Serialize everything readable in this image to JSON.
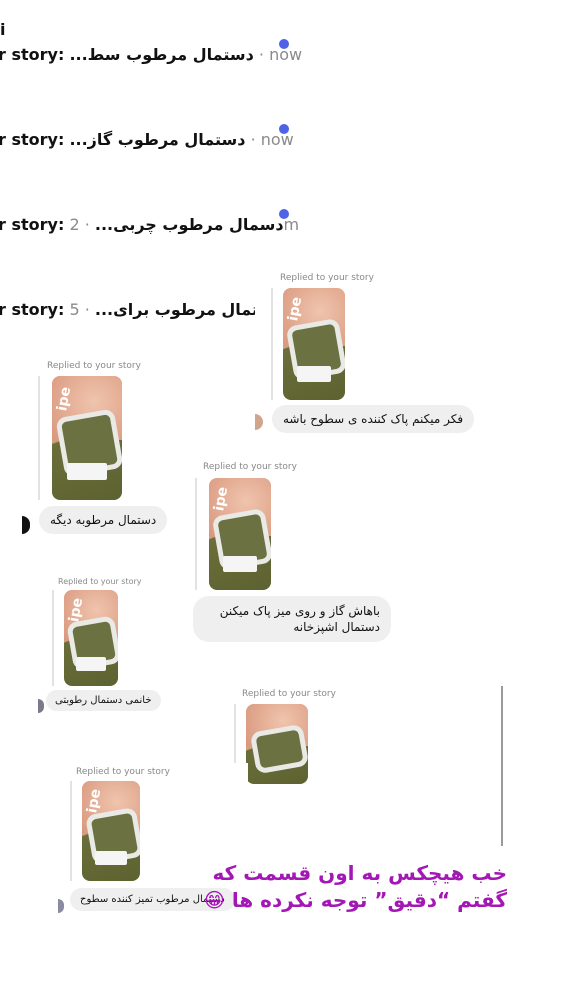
{
  "inbox": {
    "rows": [
      {
        "lead": "r story:",
        "message": "دستمال مرطوب سط...",
        "time": "· now",
        "unread": true
      },
      {
        "lead": "r story:",
        "message": "دستمال مرطوب گاز...",
        "time": "· now",
        "unread": true
      },
      {
        "lead": "r story:",
        "message": "دسمال مرطوب چربی...",
        "time": "· 2m",
        "unread": true
      },
      {
        "lead": "r story:",
        "message": "دستمال مرطوب برای...",
        "time": "· 5m",
        "unread": false
      }
    ],
    "top_fragment": "i"
  },
  "replies": [
    {
      "header": "Replied to your story",
      "message": "فکر میکنم پاک کننده ی سطوح باشه"
    },
    {
      "header": "Replied to your story",
      "message": "دستمال مرطوبه دیگه"
    },
    {
      "header": "Replied to your story",
      "message": "باهاش گاز و روی میز پاک میکنن دستمال اشپزخانه"
    },
    {
      "header": "Replied to your story",
      "message": "خانمی دستمال رطوبتی"
    },
    {
      "header": "Replied to your story",
      "message": ""
    },
    {
      "header": "Replied to your story",
      "message": "دستمال مرطوب تمیز کننده سطوح"
    }
  ],
  "caption": {
    "line1": "خب هیچکس به اون قسمت که",
    "line2": "گفتم “دقیق” توجه نکرده ها 😁"
  },
  "thumb_tag": "ipe"
}
